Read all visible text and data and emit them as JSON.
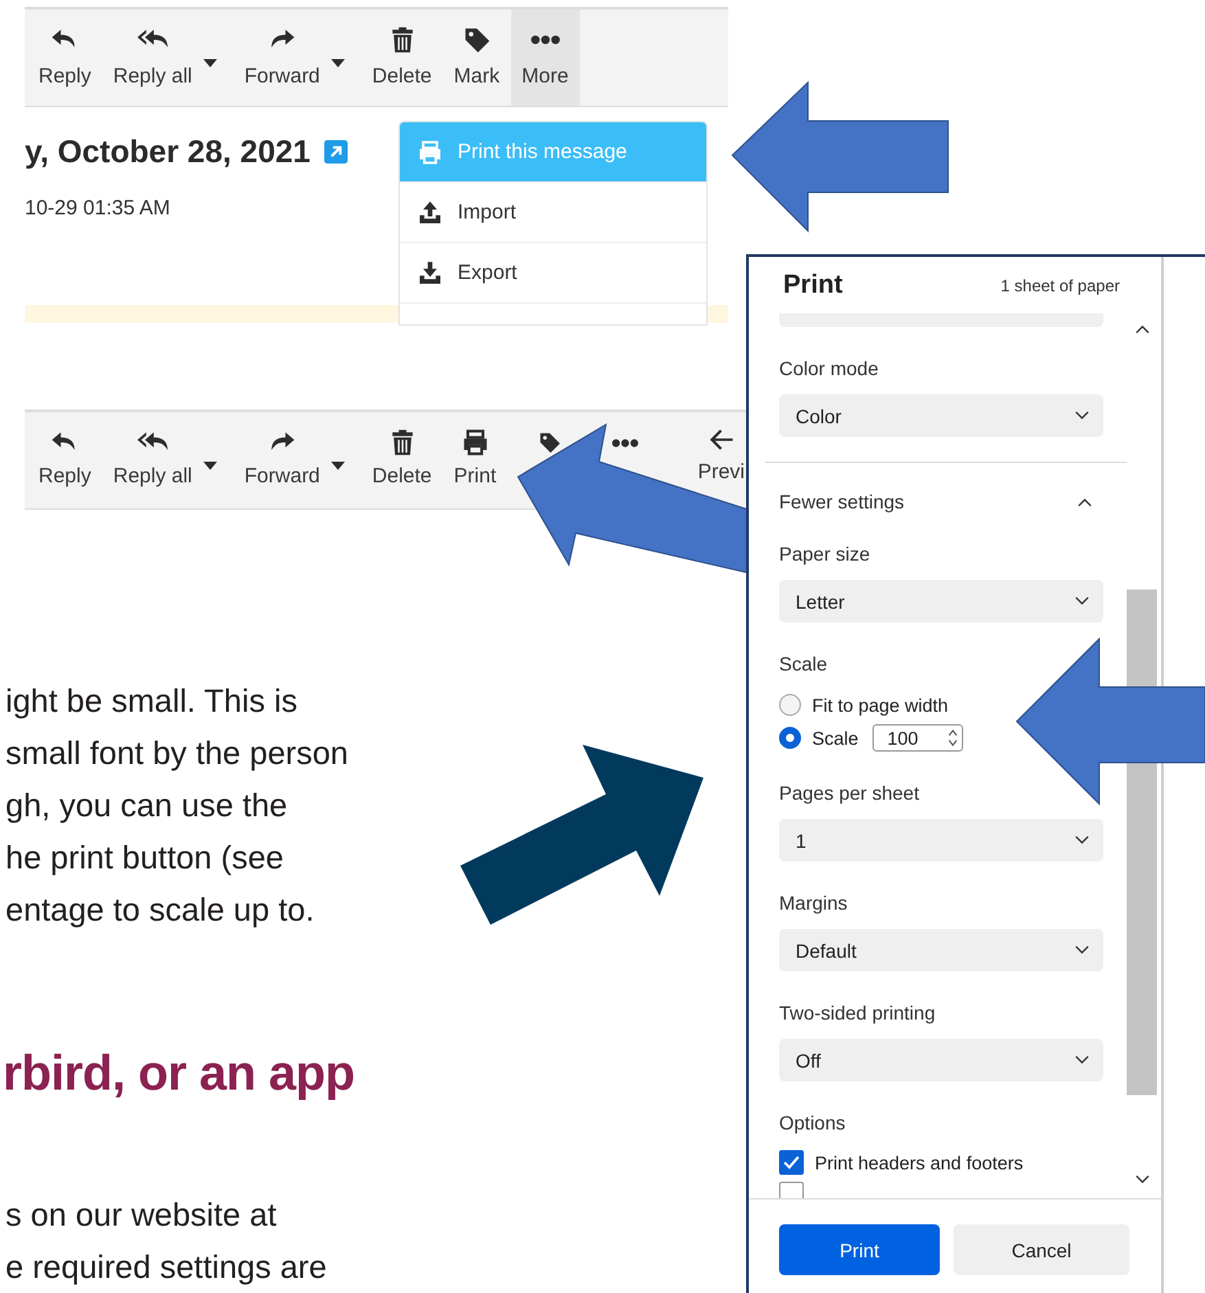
{
  "email_screenshot": {
    "toolbar": [
      {
        "kind": "reply",
        "label": "Reply",
        "dropdown": false,
        "selected": false
      },
      {
        "kind": "reply_all",
        "label": "Reply all",
        "dropdown": true,
        "selected": false
      },
      {
        "kind": "forward",
        "label": "Forward",
        "dropdown": true,
        "selected": false
      },
      {
        "kind": "delete",
        "label": "Delete",
        "dropdown": false,
        "selected": false
      },
      {
        "kind": "tag",
        "label": "Mark",
        "dropdown": false,
        "selected": false
      },
      {
        "kind": "more",
        "label": "More",
        "dropdown": false,
        "selected": true
      }
    ],
    "date_heading": "y, October 28, 2021",
    "timestamp": "10-29 01:35 AM",
    "menu": [
      {
        "kind": "print",
        "label": "Print this message",
        "selected": true
      },
      {
        "kind": "import",
        "label": "Import",
        "selected": false
      },
      {
        "kind": "export",
        "label": "Export",
        "selected": false
      }
    ]
  },
  "toolbar_screenshot": {
    "toolbar": [
      {
        "kind": "reply",
        "label": "Reply",
        "dropdown": false,
        "selected": false
      },
      {
        "kind": "reply_all",
        "label": "Reply all",
        "dropdown": true,
        "selected": false
      },
      {
        "kind": "forward",
        "label": "Forward",
        "dropdown": true,
        "selected": false
      },
      {
        "kind": "delete",
        "label": "Delete",
        "dropdown": false,
        "selected": false
      },
      {
        "kind": "print",
        "label": "Print",
        "dropdown": false,
        "selected": false
      },
      {
        "kind": "tag",
        "dropdown": false,
        "selected": false
      },
      {
        "kind": "more",
        "dropdown": false,
        "selected": false
      },
      {
        "kind": "previous",
        "label": "Previ",
        "dropdown": false,
        "selected": false
      }
    ]
  },
  "article": [
    {
      "kind": "paragraph",
      "lines": [
        "ight be small. This is",
        "small font by the person",
        "gh, you can use the",
        "he print button (see",
        "entage to scale up to."
      ]
    },
    {
      "kind": "heading",
      "text": "rbird, or an app"
    },
    {
      "kind": "paragraph",
      "lines": [
        "s on our website at",
        "e required settings are"
      ]
    }
  ],
  "print_dialog": {
    "title": "Print",
    "summary": "1 sheet of paper",
    "settings": [
      {
        "kind": "select",
        "label": "Color mode",
        "value": "Color"
      },
      {
        "kind": "toggle",
        "label": "Fewer settings",
        "expanded": true
      },
      {
        "kind": "select",
        "label": "Paper size",
        "value": "Letter"
      },
      {
        "kind": "scale",
        "label": "Scale",
        "options": [
          {
            "label": "Fit to page width",
            "selected": false
          },
          {
            "label": "Scale",
            "selected": true,
            "value": "100"
          }
        ]
      },
      {
        "kind": "select",
        "label": "Pages per sheet",
        "value": "1"
      },
      {
        "kind": "select",
        "label": "Margins",
        "value": "Default"
      },
      {
        "kind": "select",
        "label": "Two-sided printing",
        "value": "Off"
      },
      {
        "kind": "options",
        "label": "Options",
        "items": [
          {
            "label": "Print headers and footers",
            "checked": true
          },
          {
            "checked": false
          }
        ]
      }
    ],
    "buttons": [
      {
        "kind": "primary",
        "label": "Print"
      },
      {
        "kind": "secondary",
        "label": "Cancel"
      }
    ]
  }
}
